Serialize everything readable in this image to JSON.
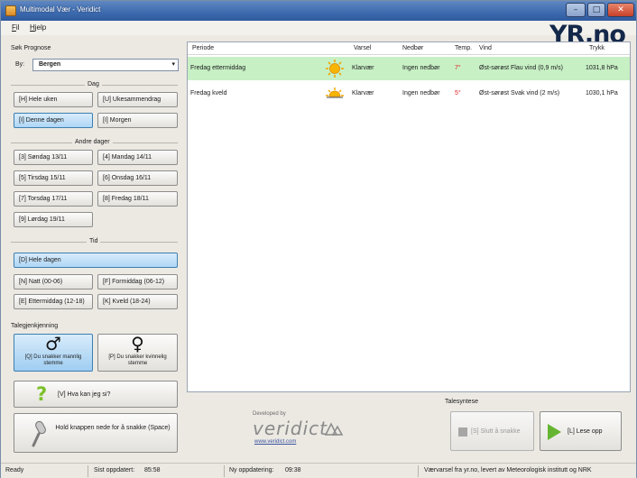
{
  "window": {
    "title": "Multimodal Vær - Veridict",
    "minimize_glyph": "–",
    "maximize_glyph": "□",
    "close_glyph": "✕"
  },
  "menu": {
    "file_key": "F",
    "file_rest": "il",
    "help_key": "H",
    "help_rest": "jelp"
  },
  "logo": {
    "text": "YR.no"
  },
  "search": {
    "label": "Søk Prognose",
    "by_label": "By:",
    "city": "Bergen",
    "arrow": "▾"
  },
  "day_group": {
    "title": "Dag",
    "buttons": [
      "[H] Hele uken",
      "[U] Ukesammendrag",
      "[I] Denne dagen",
      "[I] Morgen"
    ],
    "active_index": 2
  },
  "other_days": {
    "title": "Andre dager",
    "buttons": [
      "[3] Søndag 13/11",
      "[4] Mandag 14/11",
      "[5] Tirsdag 15/11",
      "[6] Onsdag 16/11",
      "[7] Torsdag 17/11",
      "[8] Fredag 18/11",
      "[9] Lørdag 19/11"
    ]
  },
  "time_group": {
    "title": "Tid",
    "buttons": [
      "[D] Hele dagen",
      "[N] Natt (00-06)",
      "[F] Formiddag (06-12)",
      "[E] Ettermiddag (12-18)",
      "[K] Kveld (18-24)"
    ],
    "active_index": 0
  },
  "voice": {
    "title": "Talegjenkjenning",
    "male_symbol": "♂",
    "male_label": "[Q] Du snakker mannlig stemme",
    "female_symbol": "♀",
    "female_label": "[P] Du snakker kvinnelig stemme",
    "active": "male"
  },
  "help_button": {
    "icon": "?",
    "label": "[V] Hva kan jeg si?"
  },
  "hold_button": {
    "label": "Hold knappen nede for å snakke (Space)"
  },
  "table": {
    "headers": [
      "Periode",
      "Varsel",
      "Nedbør",
      "Temp.",
      "Vind",
      "Trykk"
    ],
    "rows": [
      {
        "period": "Fredag ettermiddag",
        "icon": "sun-icon",
        "forecast": "Klarvær",
        "precip": "Ingen nedbør",
        "temp": "7°",
        "wind": "Øst-sørøst Flau vind (0,9 m/s)",
        "pressure": "1031,8 hPa",
        "highlight": true
      },
      {
        "period": "Fredag kveld",
        "icon": "sunset-icon",
        "forecast": "Klarvær",
        "precip": "Ingen nedbør",
        "temp": "5°",
        "wind": "Øst-sørøst Svak vind (2 m/s)",
        "pressure": "1030,1 hPa",
        "highlight": false
      }
    ]
  },
  "developer": {
    "developed_by": "Developed by",
    "name": "veridict",
    "url": "www.veridict.com"
  },
  "tts": {
    "title": "Talesyntese",
    "stop_label": "[S] Slutt å snakke",
    "read_label": "[L] Lese opp"
  },
  "status": {
    "state": "Ready",
    "last_update_label": "Sist oppdatert:",
    "last_update": "85:58",
    "next_update_label": "Ny oppdatering:",
    "next_update": "09:38",
    "source": "Værvarsel fra yr.no, levert av Meteorologisk institutt og NRK"
  },
  "colors": {
    "highlight_row": "#c7f0c5",
    "active_button": "#aed6f5",
    "temp_warm": "#e02020",
    "play_green": "#66b532"
  }
}
